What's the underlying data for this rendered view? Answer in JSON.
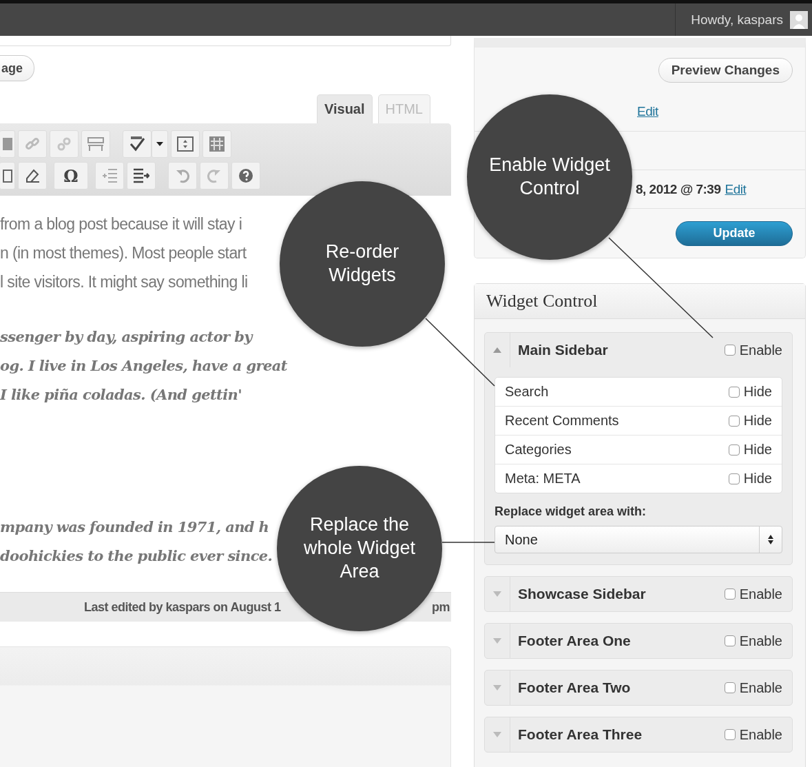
{
  "admin_bar": {
    "greeting": "Howdy, kaspars"
  },
  "editor": {
    "button": "age",
    "tabs": [
      {
        "label": "Visual",
        "selected": true
      },
      {
        "label": "HTML",
        "selected": false
      }
    ],
    "toolbar_symbol": "Ω",
    "paragraphs": [
      {
        "kind": "plain",
        "lines": [
          "from a blog post because it will stay i",
          "n (in most themes). Most people start",
          "l site visitors. It might say something li"
        ]
      },
      {
        "kind": "quote",
        "lines": [
          "ssenger by day, aspiring actor by",
          "og. I live in Los Angeles, have a great",
          "I like piña coladas. (And gettin'"
        ]
      },
      {
        "kind": "quote",
        "lines": [
          "mpany was founded in 1971, and h",
          "doohickies to the public ever since."
        ]
      }
    ],
    "status": [
      "Last edited by kaspars on August 1",
      "pm"
    ]
  },
  "publish": {
    "preview_button": "Preview Changes",
    "status_link": "Edit",
    "published_on": "8, 2012 @ 7:39",
    "date_link": "Edit",
    "update_button": "Update"
  },
  "widget_control": {
    "title": "Widget Control",
    "areas": [
      {
        "name": "Main Sidebar",
        "enable_label": "Enable",
        "enabled": false,
        "expanded": true,
        "widgets": [
          {
            "name": "Search",
            "hide_label": "Hide",
            "hidden": false
          },
          {
            "name": "Recent Comments",
            "hide_label": "Hide",
            "hidden": false
          },
          {
            "name": "Categories",
            "hide_label": "Hide",
            "hidden": false
          },
          {
            "name": "Meta: META",
            "hide_label": "Hide",
            "hidden": false
          }
        ],
        "replace_label": "Replace widget area with:",
        "replace_value": "None"
      },
      {
        "name": "Showcase Sidebar",
        "enable_label": "Enable",
        "enabled": false,
        "expanded": false
      },
      {
        "name": "Footer Area One",
        "enable_label": "Enable",
        "enabled": false,
        "expanded": false
      },
      {
        "name": "Footer Area Two",
        "enable_label": "Enable",
        "enabled": false,
        "expanded": false
      },
      {
        "name": "Footer Area Three",
        "enable_label": "Enable",
        "enabled": false,
        "expanded": false
      }
    ]
  },
  "callouts": [
    {
      "text": "Enable Widget Control"
    },
    {
      "text": "Re-order Widgets"
    },
    {
      "text": "Replace the whole Widget Area"
    }
  ]
}
